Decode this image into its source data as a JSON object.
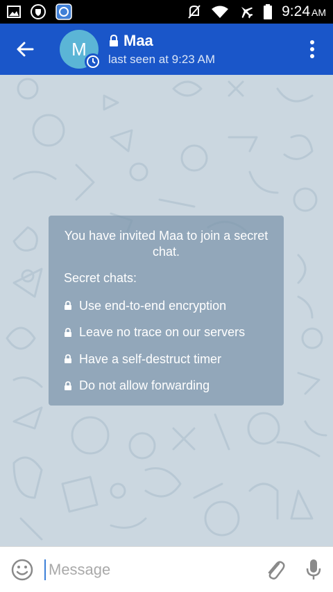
{
  "status_bar": {
    "time": "9:24",
    "ampm": "AM",
    "icons": [
      "image-icon",
      "shield-icon",
      "app-icon",
      "mute-icon",
      "wifi-icon",
      "airplane-icon",
      "battery-icon"
    ]
  },
  "header": {
    "back_icon": "arrow-left-icon",
    "avatar_letter": "M",
    "avatar_color": "#5bb5d6",
    "title": "Maa",
    "status": "last seen at 9:23 AM",
    "menu_icon": "more-vert-icon",
    "bar_color": "#1a56c9"
  },
  "secret_chat_info": {
    "intro": "You have invited Maa to join a secret chat.",
    "heading": "Secret chats:",
    "items": [
      "Use end-to-end encryption",
      "Leave no trace on our servers",
      "Have a self-destruct timer",
      "Do not allow forwarding"
    ]
  },
  "input_bar": {
    "placeholder": "Message",
    "value": ""
  }
}
